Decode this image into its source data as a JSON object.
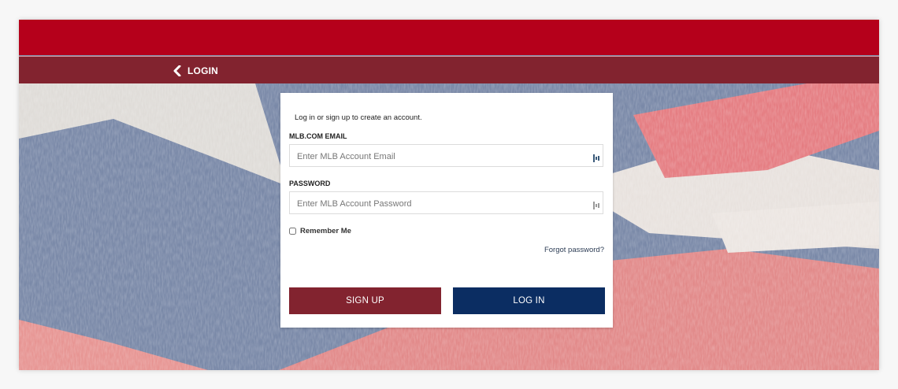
{
  "header": {
    "back_label": "LOGIN"
  },
  "form": {
    "intro": "Log in or sign up to create an account.",
    "email": {
      "label": "MLB.COM EMAIL",
      "placeholder": "Enter MLB Account Email",
      "value": ""
    },
    "password": {
      "label": "PASSWORD",
      "placeholder": "Enter MLB Account Password",
      "value": ""
    },
    "remember_me": {
      "label": "Remember Me",
      "checked": false
    },
    "forgot_password": "Forgot password?",
    "signup_button": "SIGN UP",
    "login_button": "LOG IN"
  },
  "icons": {
    "back": "chevron-left-icon",
    "email_field": "key-icon",
    "password_field": "key-icon"
  },
  "colors": {
    "top_bar": "#b5001b",
    "sub_bar": "#82232f",
    "signup_button": "#82232f",
    "login_button": "#0b2d62"
  }
}
